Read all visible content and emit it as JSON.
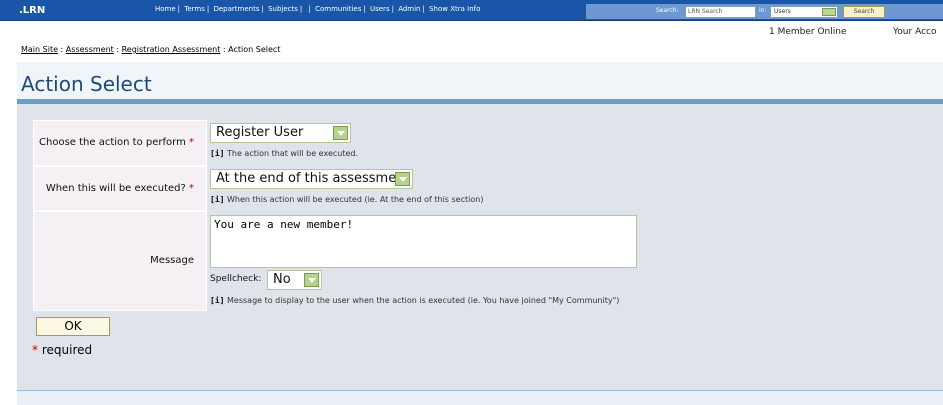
{
  "header": {
    "logo": ".LRN",
    "nav": [
      "Home",
      "Terms",
      "Departments",
      "Subjects",
      "",
      "Communities",
      "Users",
      "Admin",
      "Show Xtra Info"
    ],
    "search_label": "Search:",
    "search_placeholder": "LRN Search",
    "in_label": "in:",
    "in_value": "Users",
    "search_button": "Search",
    "online": "1 Member Online",
    "account": "Your Acco"
  },
  "breadcrumb": {
    "items": [
      "Main Site",
      "Assessment",
      "Registration Assessment"
    ],
    "current": "Action Select",
    "separator": ":"
  },
  "page": {
    "title": "Action Select"
  },
  "form": {
    "action": {
      "label": "Choose the action to perform",
      "value": "Register User",
      "help": "The action that will be executed."
    },
    "when": {
      "label": "When this will be executed?",
      "value": "At the end of this assessment",
      "help": "When this action will be executed (ie. At the end of this section)"
    },
    "message": {
      "label": "Message",
      "value": "You are a new member!",
      "spellcheck_label": "Spellcheck:",
      "spellcheck_value": "No",
      "help": "Message to display to the user when the action is executed (ie. You have joined \"My Community\")"
    },
    "help_marker": "[i]",
    "required_marker": "*",
    "ok_button": "OK",
    "required_note": "required"
  },
  "colors": {
    "topbar": "#1a56a8",
    "title": "#1f4a78",
    "required": "#cc0000"
  }
}
